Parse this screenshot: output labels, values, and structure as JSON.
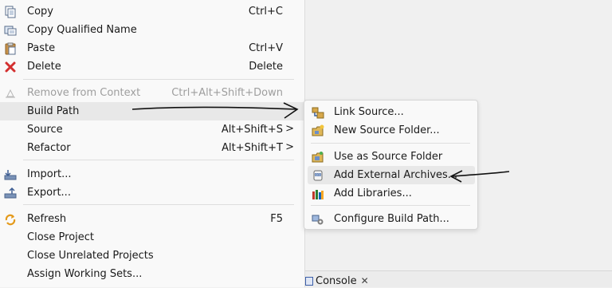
{
  "context_menu": {
    "items": [
      {
        "label": "Copy",
        "shortcut": "Ctrl+C",
        "icon": "copy-icon"
      },
      {
        "label": "Copy Qualified Name",
        "shortcut": "",
        "icon": "copy-qualified-name-icon"
      },
      {
        "label": "Paste",
        "shortcut": "Ctrl+V",
        "icon": "paste-icon"
      },
      {
        "label": "Delete",
        "shortcut": "Delete",
        "icon": "delete-icon"
      },
      {
        "label": "Remove from Context",
        "shortcut": "Ctrl+Alt+Shift+Down",
        "icon": "remove-from-context-icon",
        "disabled": true
      },
      {
        "label": "Build Path",
        "shortcut": "",
        "icon": "none",
        "submenu": true
      },
      {
        "label": "Source",
        "shortcut": "Alt+Shift+S",
        "chevron": ">"
      },
      {
        "label": "Refactor",
        "shortcut": "Alt+Shift+T",
        "chevron": ">"
      },
      {
        "label": "Import...",
        "shortcut": "",
        "icon": "import-icon"
      },
      {
        "label": "Export...",
        "shortcut": "",
        "icon": "export-icon"
      },
      {
        "label": "Refresh",
        "shortcut": "F5",
        "icon": "refresh-icon"
      },
      {
        "label": "Close Project",
        "shortcut": ""
      },
      {
        "label": "Close Unrelated Projects",
        "shortcut": ""
      },
      {
        "label": "Assign Working Sets...",
        "shortcut": ""
      }
    ]
  },
  "build_path_submenu": {
    "items": [
      {
        "label": "Link Source...",
        "icon": "link-source-icon"
      },
      {
        "label": "New Source Folder...",
        "icon": "new-source-folder-icon"
      },
      {
        "label": "Use as Source Folder",
        "icon": "use-as-source-folder-icon"
      },
      {
        "label": "Add External Archives...",
        "icon": "external-archive-jar-icon",
        "highlighted": true
      },
      {
        "label": "Add Libraries...",
        "icon": "add-libraries-icon"
      },
      {
        "label": "Configure Build Path...",
        "icon": "configure-build-path-icon"
      }
    ]
  },
  "bottom_tab": {
    "label": "Console",
    "close": "✕"
  },
  "colors": {
    "delete_red": "#d32f2f",
    "hover": "#e8e8e8",
    "disabled_text": "#9e9e9e"
  }
}
